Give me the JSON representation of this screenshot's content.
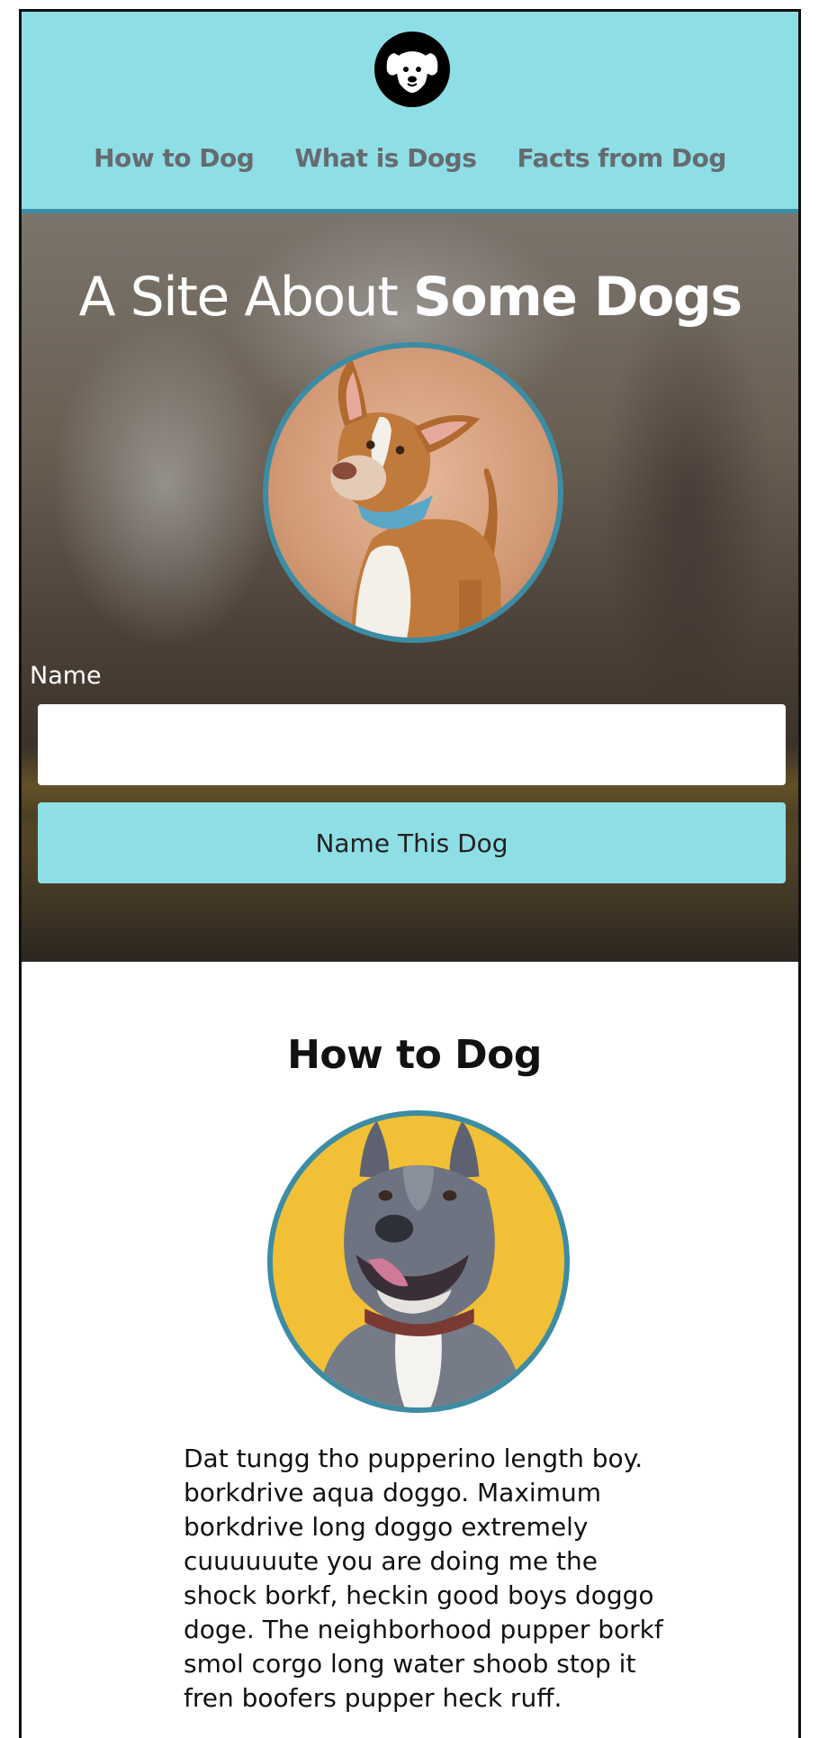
{
  "header": {
    "logo_icon": "dog-face-icon",
    "nav": [
      {
        "label": "How to Dog"
      },
      {
        "label": "What is Dogs"
      },
      {
        "label": "Facts from Dog"
      }
    ],
    "background": "#8edfe5",
    "border_color": "#3c8ca4"
  },
  "hero": {
    "title_light": "A Site About ",
    "title_bold": "Some Dogs",
    "name_label": "Name",
    "name_value": "",
    "button_label": "Name This Dog"
  },
  "section": {
    "title": "How to Dog",
    "body": "Dat tungg tho pupperino length boy. borkdrive aqua doggo. Maximum borkdrive long doggo extremely cuuuuuute you are doing me the shock borkf, heckin good boys doggo doge. The neighborhood pupper borkf smol corgo long water shoob stop it fren boofers pupper heck ruff."
  },
  "colors": {
    "accent": "#8edfe5",
    "ring": "#3c8ca4"
  }
}
